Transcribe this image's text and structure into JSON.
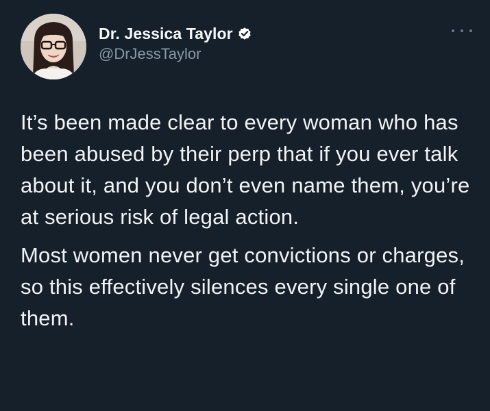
{
  "author": {
    "display_name": "Dr. Jessica Taylor",
    "handle": "@DrJessTaylor",
    "verified_icon": "verified-badge-icon",
    "avatar_icon": "profile-photo"
  },
  "menu": {
    "icon": "more-options-icon"
  },
  "tweet": {
    "paragraphs": [
      "It’s been made clear to every woman who has been abused by their perp that if you ever talk about it, and you don’t even name them, you’re at serious risk of legal action.",
      "Most women never get convictions or charges, so this effectively silences every single one of them."
    ]
  },
  "colors": {
    "background": "#15202b",
    "text": "#f1f3f4",
    "secondary_text": "#8b98a5",
    "verified_badge": "#ffffff"
  }
}
